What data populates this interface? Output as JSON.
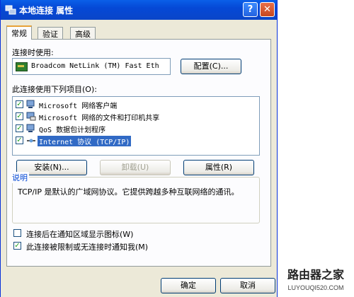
{
  "window": {
    "title": "本地连接 属性",
    "help_glyph": "?",
    "close_glyph": "✕"
  },
  "tabs": [
    {
      "label": "常规"
    },
    {
      "label": "验证"
    },
    {
      "label": "高级"
    }
  ],
  "general": {
    "connect_using_label": "连接时使用:",
    "adapter_name": "Broadcom NetLink (TM) Fast Eth",
    "configure_button": "配置(C)...",
    "items_label": "此连接使用下列项目(O):",
    "items": [
      {
        "label": "Microsoft 网络客户端",
        "checked": true,
        "selected": false,
        "icon": "network-client-icon"
      },
      {
        "label": "Microsoft 网络的文件和打印机共享",
        "checked": true,
        "selected": false,
        "icon": "file-printer-sharing-icon"
      },
      {
        "label": "QoS 数据包计划程序",
        "checked": true,
        "selected": false,
        "icon": "qos-scheduler-icon"
      },
      {
        "label": "Internet 协议 (TCP/IP)",
        "checked": true,
        "selected": true,
        "icon": "protocol-icon"
      }
    ],
    "install_button": "安装(N)...",
    "uninstall_button": "卸载(U)",
    "properties_button": "属性(R)",
    "description_title": "说明",
    "description_text": "TCP/IP 是默认的广域网协议。它提供跨越多种互联网络的通讯。",
    "show_icon_label": "连接后在通知区域显示图标(W)",
    "show_icon_checked": false,
    "notify_label": "此连接被限制或无连接时通知我(M)",
    "notify_checked": true,
    "check_glyph": "✓"
  },
  "footer": {
    "ok_button": "确定",
    "cancel_button": "取消"
  },
  "watermark": {
    "logo_text": "路由器之家",
    "url_text": "LUYOUQI520.COM"
  },
  "colors": {
    "title_bar": "#0548d6",
    "selection": "#316ac5",
    "group_title": "#0046d5"
  }
}
